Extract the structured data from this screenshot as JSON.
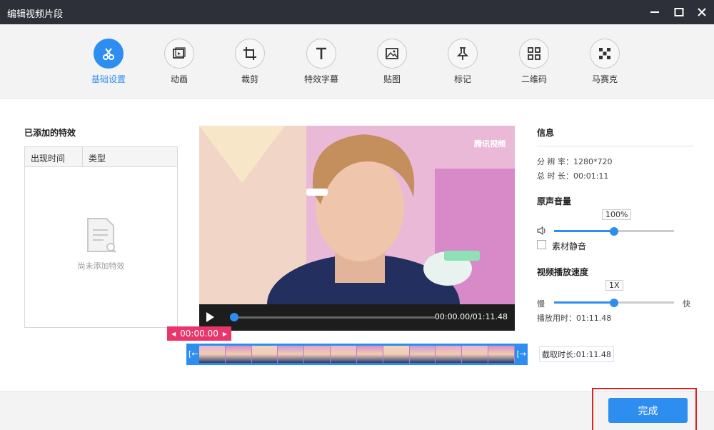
{
  "window": {
    "title": "编辑视频片段",
    "controls": [
      "minimize-icon",
      "maximize-icon",
      "close-icon"
    ]
  },
  "toolbar": {
    "items": [
      {
        "label": "基础设置",
        "icon": "scissors-icon",
        "active": true
      },
      {
        "label": "动画",
        "icon": "animation-icon",
        "active": false
      },
      {
        "label": "裁剪",
        "icon": "crop-icon",
        "active": false
      },
      {
        "label": "特效字幕",
        "icon": "text-icon",
        "active": false
      },
      {
        "label": "贴图",
        "icon": "image-icon",
        "active": false
      },
      {
        "label": "标记",
        "icon": "pin-icon",
        "active": false
      },
      {
        "label": "二维码",
        "icon": "qrcode-icon",
        "active": false
      },
      {
        "label": "马赛克",
        "icon": "mosaic-icon",
        "active": false
      }
    ]
  },
  "effects_panel": {
    "title": "已添加的特效",
    "columns": [
      "出现时间",
      "类型"
    ],
    "empty_text": "尚未添加特效"
  },
  "player": {
    "watermark": "腾讯视频",
    "timecode": "00:00.00/01:11.48",
    "progress": 0
  },
  "timeline": {
    "start_marker": "00:00.00",
    "clip_length": "截取时长:01:11.48",
    "left_cap": "[←",
    "right_cap": "[→"
  },
  "info": {
    "title": "信息",
    "resolution_label": "分 辨 率：",
    "resolution_value": "1280*720",
    "duration_label": "总 时 长：",
    "duration_value": "00:01:11",
    "volume_title": "原声音量",
    "volume_value": "100%",
    "volume_level": 0.5,
    "mute_label": "素材静音",
    "speed_title": "视频播放速度",
    "speed_value": "1X",
    "speed_level": 0.5,
    "slow_label": "慢",
    "fast_label": "快",
    "play_time_label": "播放用时：",
    "play_time_value": "01:11.48"
  },
  "footer": {
    "done_label": "完成"
  },
  "colors": {
    "accent": "#2e8ef0",
    "titlebar": "#2d3038",
    "marker": "#e8366a"
  }
}
